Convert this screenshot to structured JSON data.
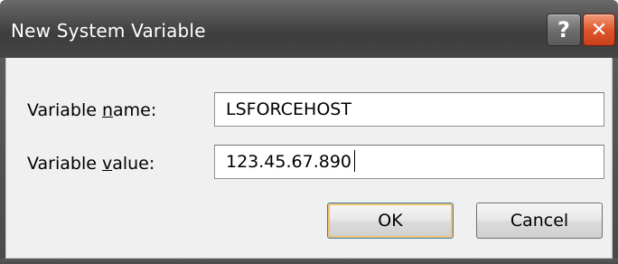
{
  "window": {
    "title": "New System Variable",
    "help_glyph": "?",
    "close_glyph": "✕"
  },
  "form": {
    "name_label_prefix": "Variable ",
    "name_label_accel": "n",
    "name_label_suffix": "ame:",
    "name_value": "LSFORCEHOST",
    "value_label_prefix": "Variable ",
    "value_label_accel": "v",
    "value_label_suffix": "alue:",
    "value_value": "123.45.67.890"
  },
  "buttons": {
    "ok_label": "OK",
    "cancel_label": "Cancel"
  },
  "colors": {
    "titlebar": "#4a4a4a",
    "close": "#e0562d",
    "default_button_border": "#3c7fb1"
  },
  "icons": {
    "help": "help-icon",
    "close": "close-icon"
  }
}
